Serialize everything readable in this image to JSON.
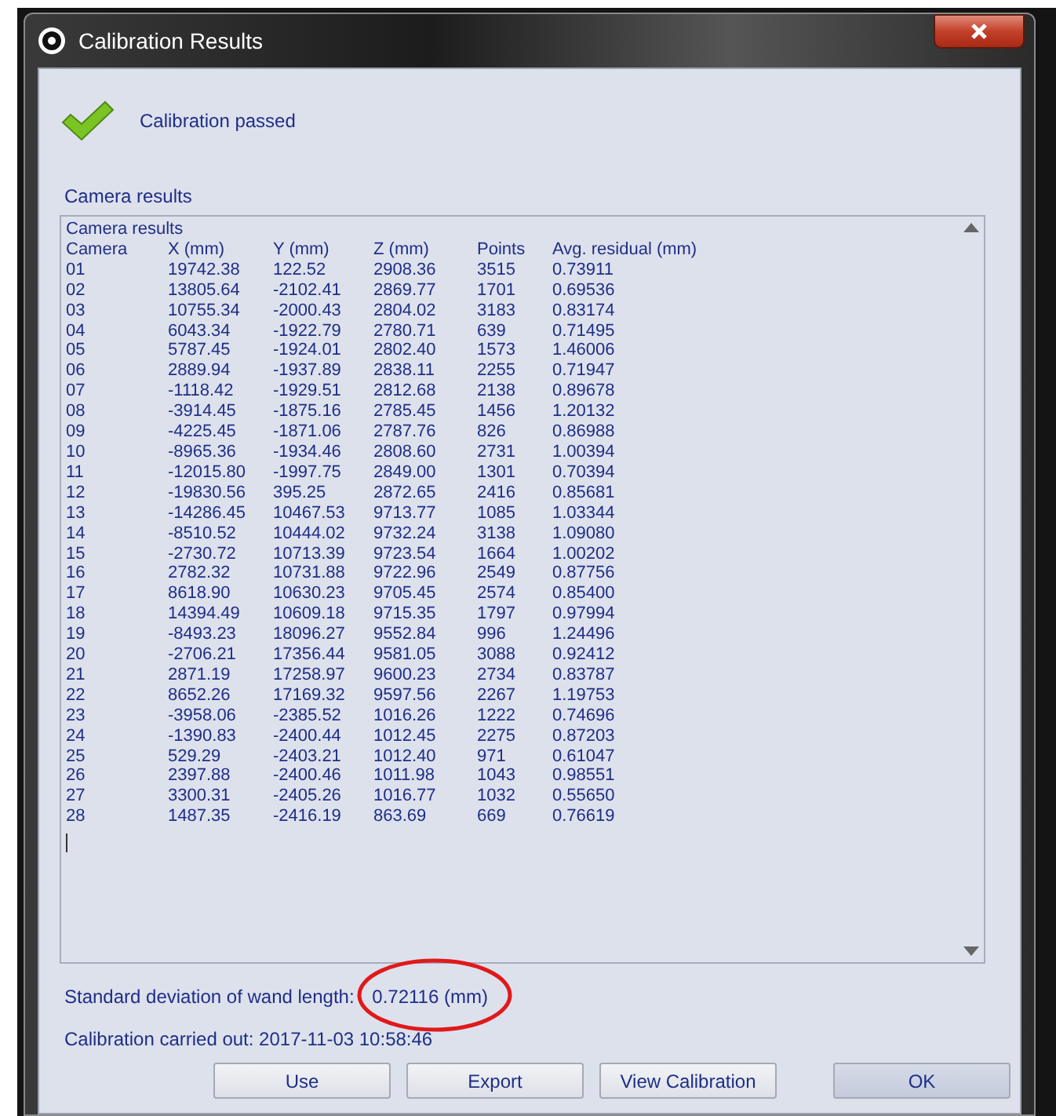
{
  "window": {
    "title": "Calibration Results"
  },
  "status": {
    "kind": "passed",
    "message": "Calibration passed"
  },
  "section_label": "Camera results",
  "results": {
    "title": "Camera results",
    "columns": [
      "Camera",
      "X (mm)",
      "Y (mm)",
      "Z (mm)",
      "Points",
      "Avg. residual (mm)"
    ],
    "rows": [
      [
        "01",
        "19742.38",
        "122.52",
        "2908.36",
        "3515",
        "0.73911"
      ],
      [
        "02",
        "13805.64",
        "-2102.41",
        "2869.77",
        "1701",
        "0.69536"
      ],
      [
        "03",
        "10755.34",
        "-2000.43",
        "2804.02",
        "3183",
        "0.83174"
      ],
      [
        "04",
        "6043.34",
        "-1922.79",
        "2780.71",
        "639",
        "0.71495"
      ],
      [
        "05",
        "5787.45",
        "-1924.01",
        "2802.40",
        "1573",
        "1.46006"
      ],
      [
        "06",
        "2889.94",
        "-1937.89",
        "2838.11",
        "2255",
        "0.71947"
      ],
      [
        "07",
        "-1118.42",
        "-1929.51",
        "2812.68",
        "2138",
        "0.89678"
      ],
      [
        "08",
        "-3914.45",
        "-1875.16",
        "2785.45",
        "1456",
        "1.20132"
      ],
      [
        "09",
        "-4225.45",
        "-1871.06",
        "2787.76",
        "826",
        "0.86988"
      ],
      [
        "10",
        "-8965.36",
        "-1934.46",
        "2808.60",
        "2731",
        "1.00394"
      ],
      [
        "11",
        "-12015.80",
        "-1997.75",
        "2849.00",
        "1301",
        "0.70394"
      ],
      [
        "12",
        "-19830.56",
        "395.25",
        "2872.65",
        "2416",
        "0.85681"
      ],
      [
        "13",
        "-14286.45",
        "10467.53",
        "9713.77",
        "1085",
        "1.03344"
      ],
      [
        "14",
        "-8510.52",
        "10444.02",
        "9732.24",
        "3138",
        "1.09080"
      ],
      [
        "15",
        "-2730.72",
        "10713.39",
        "9723.54",
        "1664",
        "1.00202"
      ],
      [
        "16",
        "2782.32",
        "10731.88",
        "9722.96",
        "2549",
        "0.87756"
      ],
      [
        "17",
        "8618.90",
        "10630.23",
        "9705.45",
        "2574",
        "0.85400"
      ],
      [
        "18",
        "14394.49",
        "10609.18",
        "9715.35",
        "1797",
        "0.97994"
      ],
      [
        "19",
        "-8493.23",
        "18096.27",
        "9552.84",
        "996",
        "1.24496"
      ],
      [
        "20",
        "-2706.21",
        "17356.44",
        "9581.05",
        "3088",
        "0.92412"
      ],
      [
        "21",
        "2871.19",
        "17258.97",
        "9600.23",
        "2734",
        "0.83787"
      ],
      [
        "22",
        "8652.26",
        "17169.32",
        "9597.56",
        "2267",
        "1.19753"
      ],
      [
        "23",
        "-3958.06",
        "-2385.52",
        "1016.26",
        "1222",
        "0.74696"
      ],
      [
        "24",
        "-1390.83",
        "-2400.44",
        "1012.45",
        "2275",
        "0.87203"
      ],
      [
        "25",
        "529.29",
        "-2403.21",
        "1012.40",
        "971",
        "0.61047"
      ],
      [
        "26",
        "2397.88",
        "-2400.46",
        "1011.98",
        "1043",
        "0.98551"
      ],
      [
        "27",
        "3300.31",
        "-2405.26",
        "1016.77",
        "1032",
        "0.55650"
      ],
      [
        "28",
        "1487.35",
        "-2416.19",
        "863.69",
        "669",
        "0.76619"
      ]
    ]
  },
  "wand_deviation": {
    "label": "Standard deviation of wand length:",
    "value": "0.72116",
    "unit": "(mm)",
    "circled": true
  },
  "carried_out": "Calibration carried out: 2017-11-03 10:58:46",
  "buttons": [
    {
      "label": "Use",
      "default": false
    },
    {
      "label": "Export",
      "default": false
    },
    {
      "label": "View Calibration",
      "default": false
    },
    {
      "label": "OK",
      "default": true
    }
  ]
}
